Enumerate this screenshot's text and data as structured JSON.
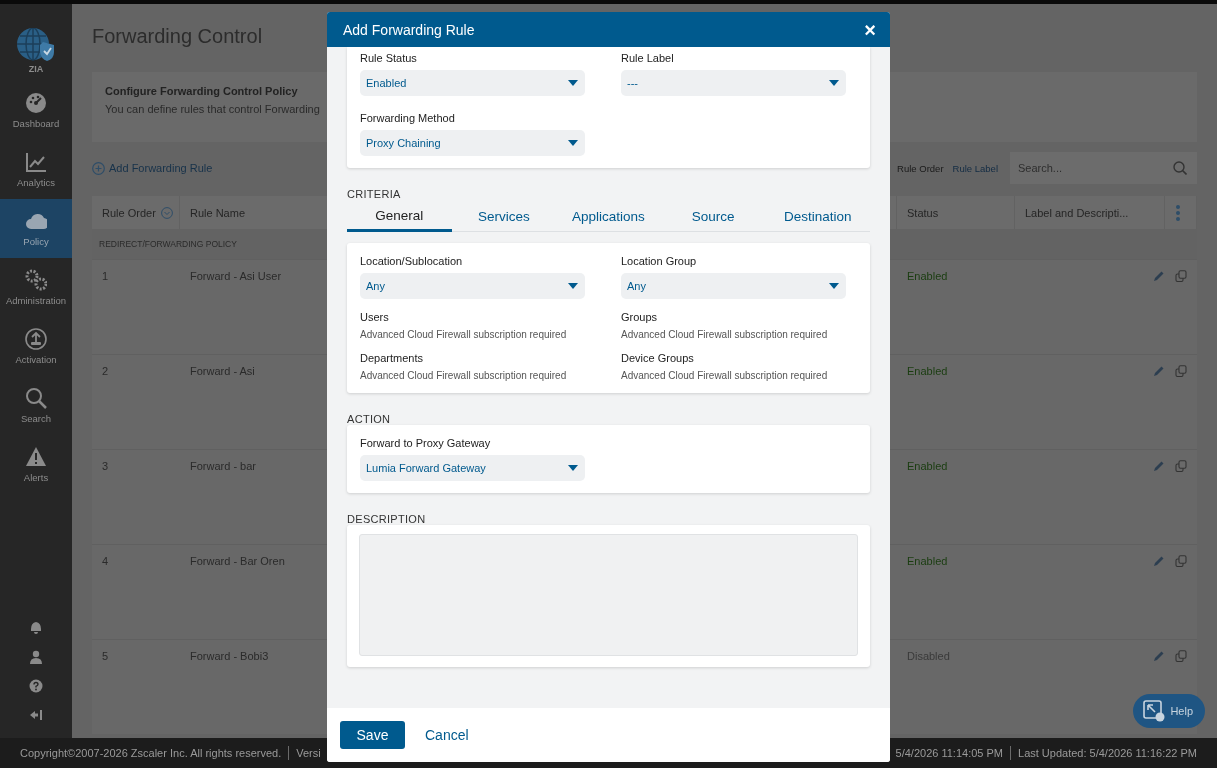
{
  "sidebar": {
    "logo_label": "ZIA",
    "items": [
      {
        "label": "Dashboard",
        "selected": false
      },
      {
        "label": "Analytics",
        "selected": false
      },
      {
        "label": "Policy",
        "selected": true
      },
      {
        "label": "Administration",
        "selected": false
      },
      {
        "label": "Activation",
        "selected": false
      },
      {
        "label": "Search",
        "selected": false
      },
      {
        "label": "Alerts",
        "selected": false
      }
    ]
  },
  "page": {
    "title": "Forwarding Control",
    "info": {
      "title": "Configure Forwarding Control Policy",
      "text": "You can define rules that control Forwarding"
    },
    "add_button": "Add Forwarding Rule",
    "sort_options": [
      {
        "label": "Rule Order",
        "selected": true
      },
      {
        "label": "Rule Label",
        "selected": false
      }
    ],
    "search": {
      "placeholder": "Search..."
    },
    "table": {
      "columns": [
        "Rule Order",
        "Rule Name",
        "Status",
        "Label and Descripti..."
      ],
      "group": "REDIRECT/FORWARDING POLICY",
      "rows": [
        {
          "order": "1",
          "name": "Forward - Asi User",
          "status": "Enabled",
          "enabled": true
        },
        {
          "order": "2",
          "name": "Forward - Asi",
          "status": "Enabled",
          "enabled": true
        },
        {
          "order": "3",
          "name": "Forward - bar",
          "status": "Enabled",
          "enabled": true
        },
        {
          "order": "4",
          "name": "Forward - Bar Oren",
          "status": "Enabled",
          "enabled": true
        },
        {
          "order": "5",
          "name": "Forward - Bobi3",
          "status": "Disabled",
          "enabled": false
        }
      ]
    }
  },
  "help_button": "Help",
  "status_bar": {
    "copyright": "Copyright©2007-2026 Zscaler Inc. All rights reserved.",
    "version": "Versi",
    "login_time": "5/4/2026 11:14:05 PM",
    "last_updated": "Last Updated: 5/4/2026 11:16:22 PM"
  },
  "modal": {
    "title": "Add Forwarding Rule",
    "close": "×",
    "top_fields": [
      {
        "label": "Rule Status",
        "value": "Enabled"
      },
      {
        "label": "Rule Label",
        "value": "---"
      },
      {
        "label": "Forwarding Method",
        "value": "Proxy Chaining"
      }
    ],
    "criteria_heading": "CRITERIA",
    "tabs": [
      {
        "label": "General",
        "selected": true
      },
      {
        "label": "Services",
        "selected": false
      },
      {
        "label": "Applications",
        "selected": false
      },
      {
        "label": "Source",
        "selected": false
      },
      {
        "label": "Destination",
        "selected": false
      }
    ],
    "criteria_fields": [
      {
        "kind": "select",
        "label": "Location/Sublocation",
        "value": "Any"
      },
      {
        "kind": "select",
        "label": "Location Group",
        "value": "Any"
      },
      {
        "kind": "note",
        "label": "Users",
        "note": "Advanced Cloud Firewall subscription required"
      },
      {
        "kind": "note",
        "label": "Groups",
        "note": "Advanced Cloud Firewall subscription required"
      },
      {
        "kind": "note",
        "label": "Departments",
        "note": "Advanced Cloud Firewall subscription required"
      },
      {
        "kind": "note",
        "label": "Device Groups",
        "note": "Advanced Cloud Firewall subscription required"
      }
    ],
    "action_heading": "ACTION",
    "action_fields": [
      {
        "label": "Forward to Proxy Gateway",
        "value": "Lumia Forward Gateway"
      }
    ],
    "description_heading": "DESCRIPTION",
    "save": "Save",
    "cancel": "Cancel"
  }
}
